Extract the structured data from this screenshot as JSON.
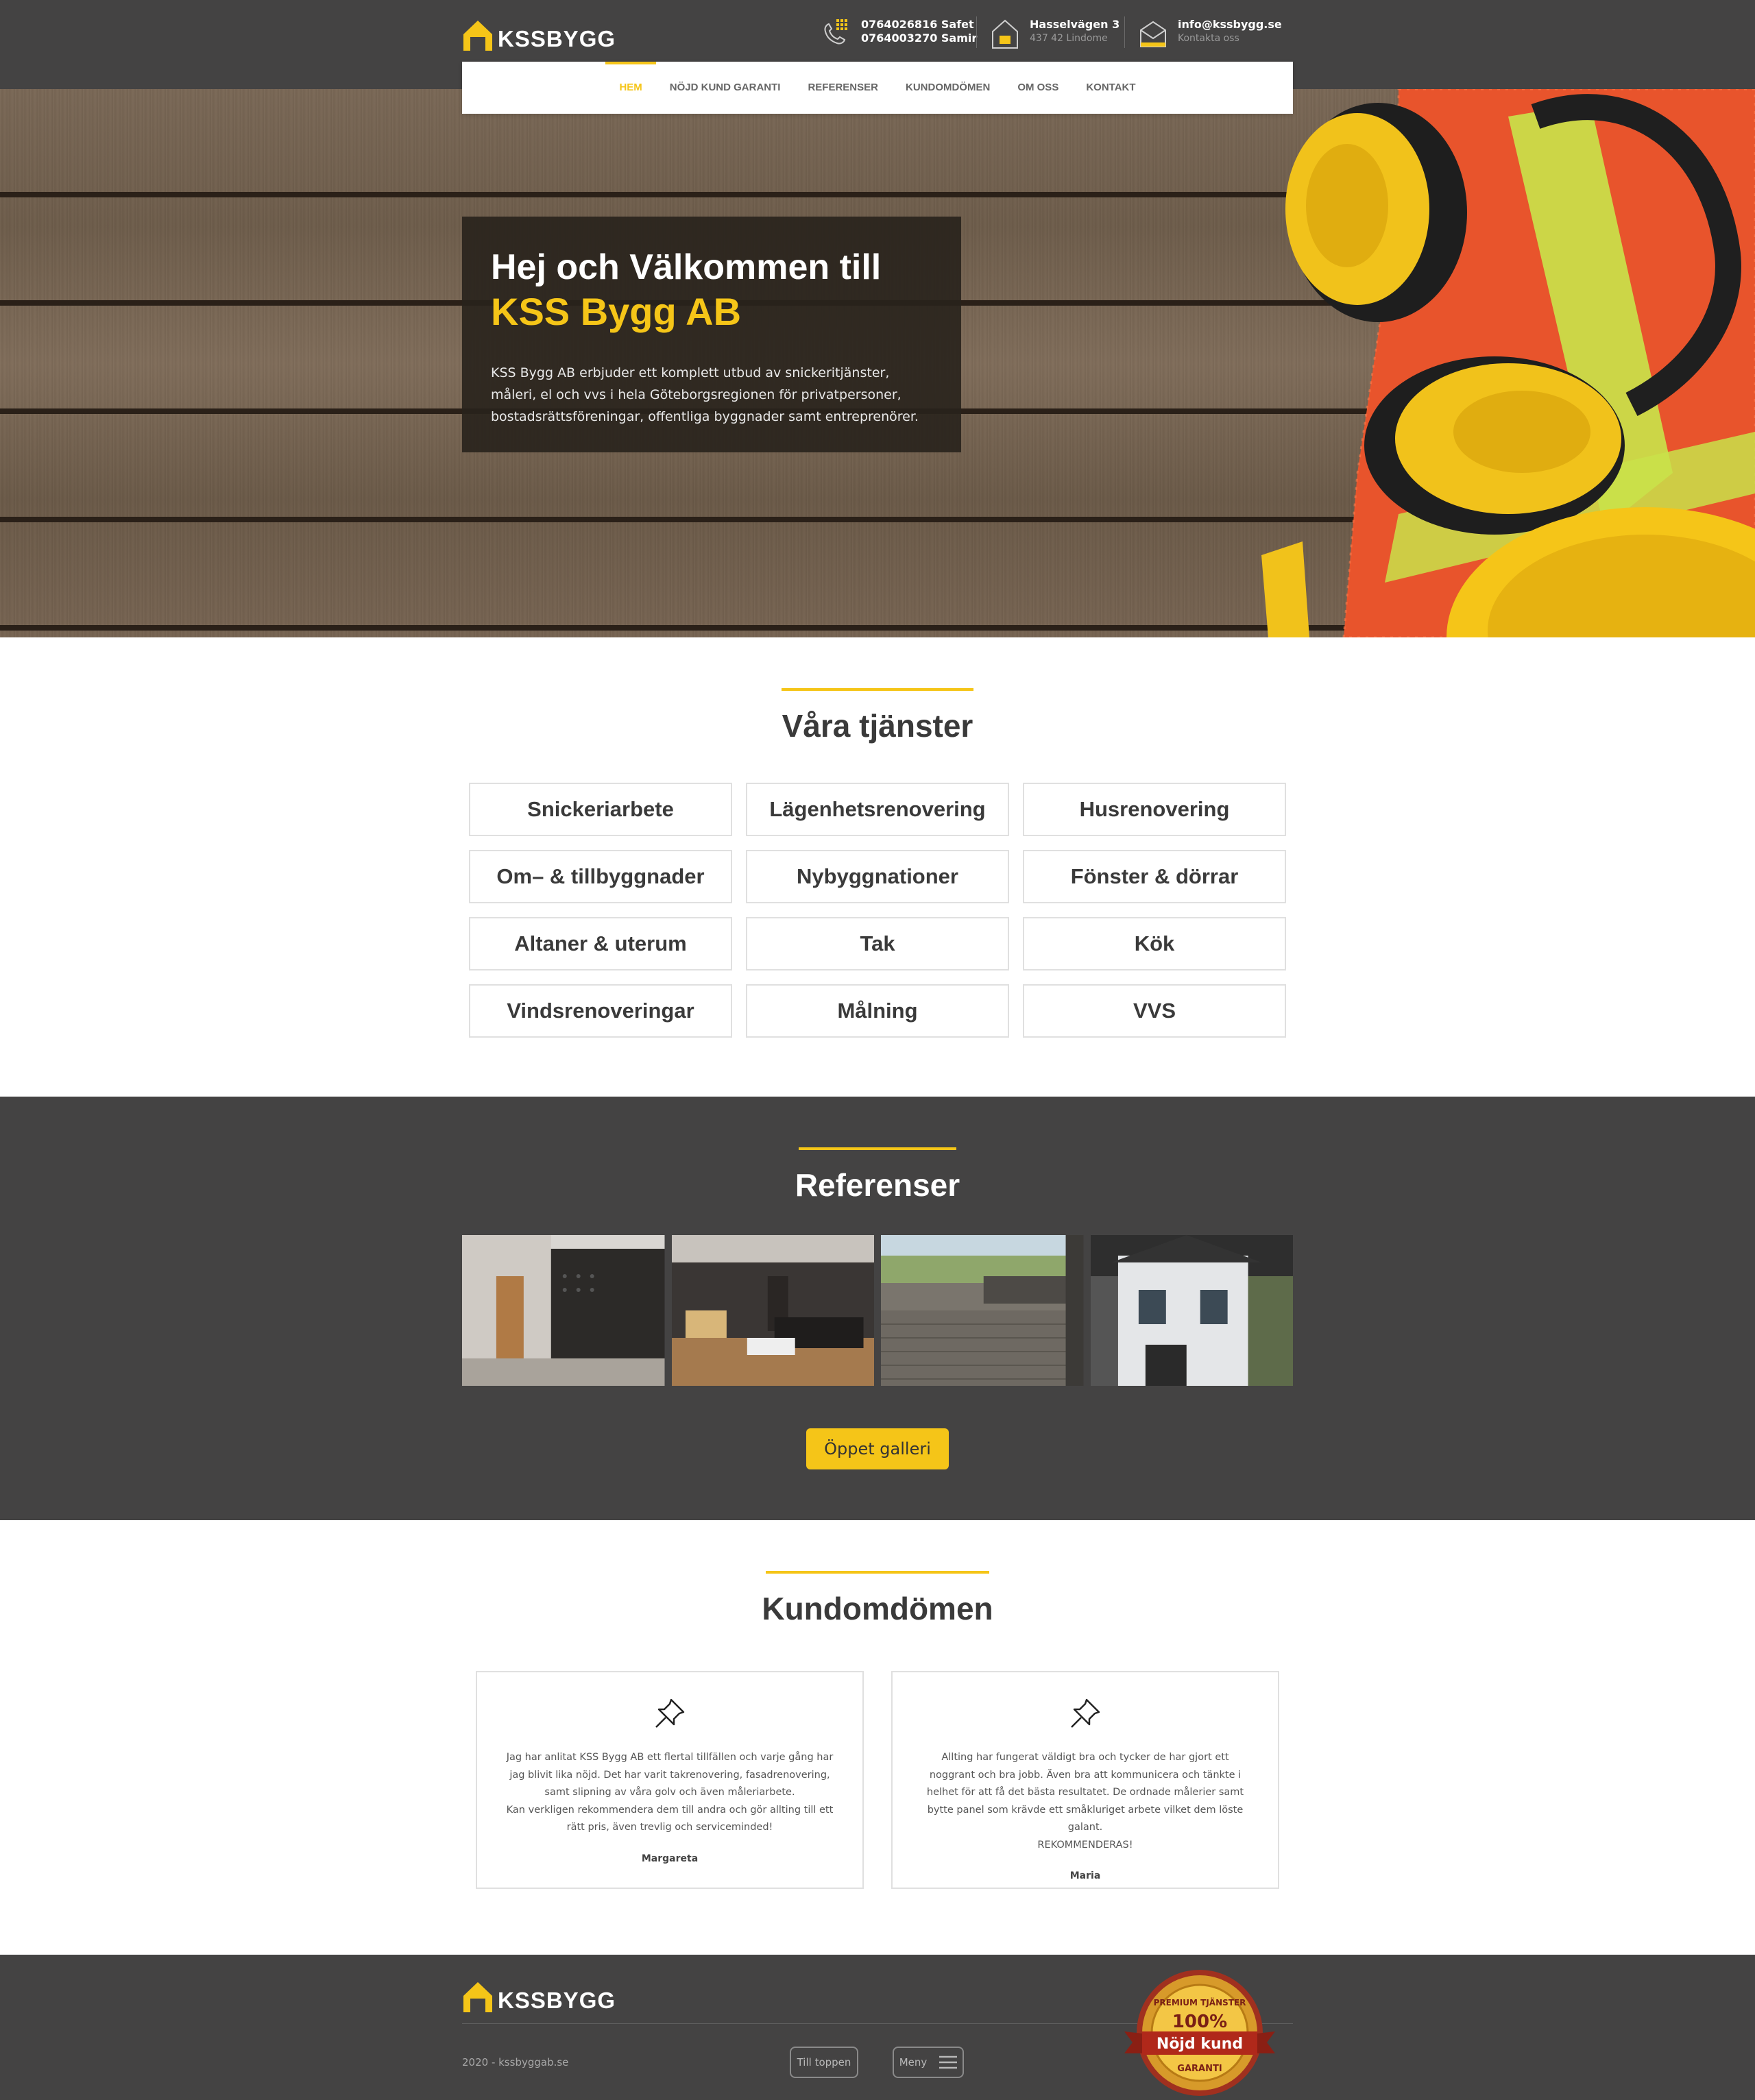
{
  "brand": {
    "name": "KSSBYGG"
  },
  "header": {
    "phone1": "0764026816 Safet",
    "phone2": "0764003270 Samir",
    "address1": "Hasselvägen 3",
    "address2": "437 42 Lindome",
    "email": "info@kssbygg.se",
    "email_sub": "Kontakta oss"
  },
  "nav": {
    "items": [
      "HEM",
      "NÖJD KUND GARANTI",
      "REFERENSER",
      "KUNDOMDÖMEN",
      "OM OSS",
      "KONTAKT"
    ],
    "active": "HEM"
  },
  "hero": {
    "title_line1": "Hej och Välkommen till",
    "title_line2": "KSS Bygg AB",
    "text": "KSS Bygg AB erbjuder ett komplett utbud av snickeritjänster, måleri, el och vvs i hela Göteborgsregionen för privatpersoner, bostadsrättsföreningar, offentliga byggnader samt entreprenörer."
  },
  "services": {
    "title": "Våra tjänster",
    "items": [
      "Snickeriarbete",
      "Lägenhetsrenovering",
      "Husrenovering",
      "Om– & tillbyggnader",
      "Nybyggnationer",
      "Fönster & dörrar",
      "Altaner & uterum",
      "Tak",
      "Kök",
      "Vindsrenoveringar",
      "Målning",
      "VVS"
    ]
  },
  "references": {
    "title": "Referenser",
    "button": "Öppet galleri"
  },
  "reviews": {
    "title": "Kundomdömen",
    "items": [
      {
        "text": "Jag har anlitat KSS Bygg AB ett flertal tillfällen och varje gång har jag blivit lika nöjd. Det har varit takrenovering, fasadrenovering, samt slipning av våra golv och även måleriarbete.\nKan verkligen rekommendera dem till andra och gör allting till ett rätt pris, även trevlig och serviceminded!",
        "author": "Margareta"
      },
      {
        "text": "Allting har fungerat väldigt bra och tycker de har gjort ett noggrant och bra jobb. Även bra att kommunicera och tänkte i helhet för att få det bästa resultatet. De ordnade målerier samt bytte panel som krävde ett småkluriget arbete vilket dem löste galant.\nREKOMMENDERAS!",
        "author": "Maria"
      }
    ]
  },
  "footer": {
    "copyright": "2020 - kssbyggab.se",
    "to_top": "Till toppen",
    "menu": "Meny",
    "badge": {
      "arc": "PREMIUM TJÄNSTER",
      "percent": "100%",
      "ribbon": "Nöjd kund",
      "bottom": "GARANTI"
    }
  },
  "colors": {
    "accent": "#f5c518",
    "dark": "#444343"
  }
}
